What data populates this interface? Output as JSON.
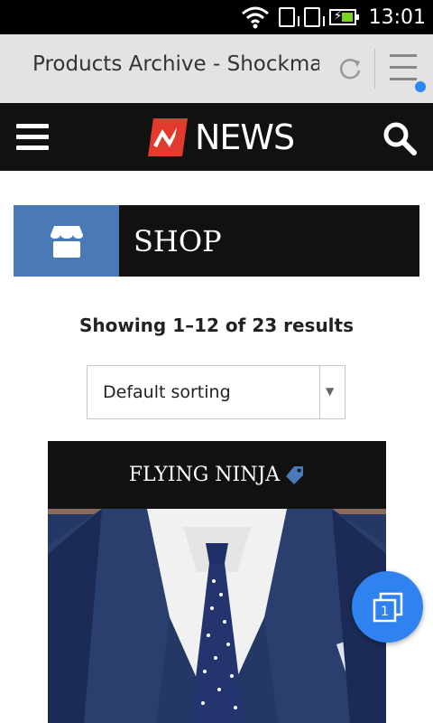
{
  "status_bar": {
    "time": "13:01",
    "icons": [
      "wifi-icon",
      "sim1-icon",
      "sim2-icon",
      "battery-charging-icon"
    ]
  },
  "browser": {
    "page_title": "Products Archive - Shockmag",
    "icons": [
      "reload-icon",
      "menu-icon",
      "notification-dot"
    ]
  },
  "site_header": {
    "logo_text": "NEWS",
    "icons": [
      "hamburger-icon",
      "logo-mark",
      "search-icon"
    ]
  },
  "shop_banner": {
    "title": "SHOP",
    "icon": "store-icon",
    "icon_bg": "#4a79b7"
  },
  "results_text": "Showing 1–12 of 23 results",
  "sorting": {
    "selected": "Default sorting"
  },
  "product": {
    "title": "FLYING NINJA",
    "tag_icon": "tag-icon",
    "tag_color": "#4a79b7"
  },
  "fab": {
    "count": "1",
    "icon": "tabs-icon",
    "color": "#2f82ef"
  }
}
